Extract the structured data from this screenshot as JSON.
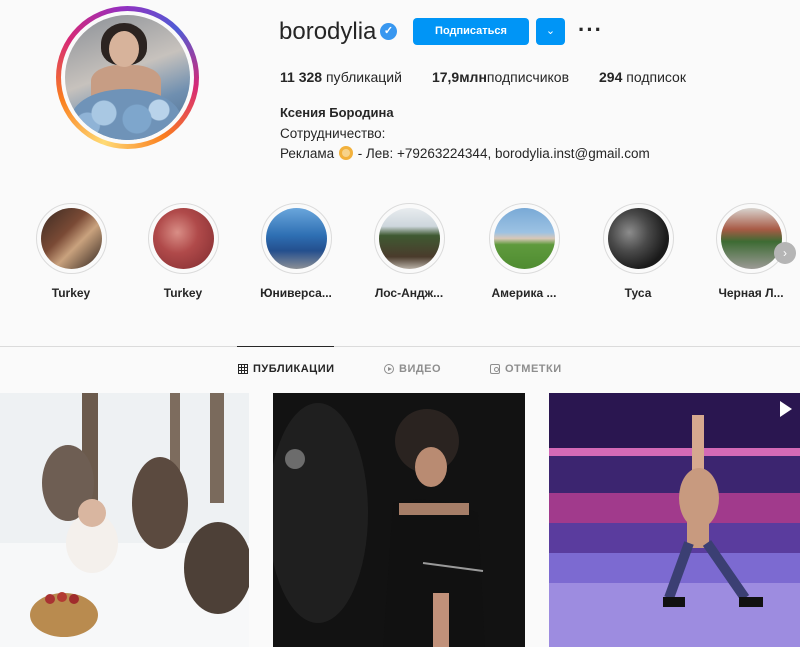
{
  "profile": {
    "username": "borodylia",
    "verified_icon": "verified-badge-icon",
    "follow_label": "Подписаться",
    "dropdown_icon": "chevron-down-icon",
    "more_icon": "more-dots-icon",
    "stats": {
      "posts_count": "11 328",
      "posts_label": "публикаций",
      "followers_count": "17,9млн",
      "followers_label": "подписчиков",
      "following_count": "294",
      "following_label": "подписок"
    },
    "full_name": "Ксения Бородина",
    "bio_line1": "Сотрудничество:",
    "bio_line2_prefix": "Реклама",
    "bio_line2_suffix": "- Лев: +79263224344, borodylia.inst@gmail.com"
  },
  "highlights": [
    {
      "label": "Turkey"
    },
    {
      "label": "Turkey"
    },
    {
      "label": "Юниверса..."
    },
    {
      "label": "Лос-Андж..."
    },
    {
      "label": "Америка ..."
    },
    {
      "label": "Туса"
    },
    {
      "label": "Черная Л..."
    }
  ],
  "tabs": [
    {
      "label": "ПУБЛИКАЦИИ",
      "icon": "grid-icon",
      "active": true
    },
    {
      "label": "ВИДЕО",
      "icon": "video-icon",
      "active": false
    },
    {
      "label": "ОТМЕТКИ",
      "icon": "tag-icon",
      "active": false
    }
  ],
  "colors": {
    "accent": "#0095f6",
    "background": "#fafafa",
    "text": "#262626",
    "muted": "#8e8e8e"
  }
}
